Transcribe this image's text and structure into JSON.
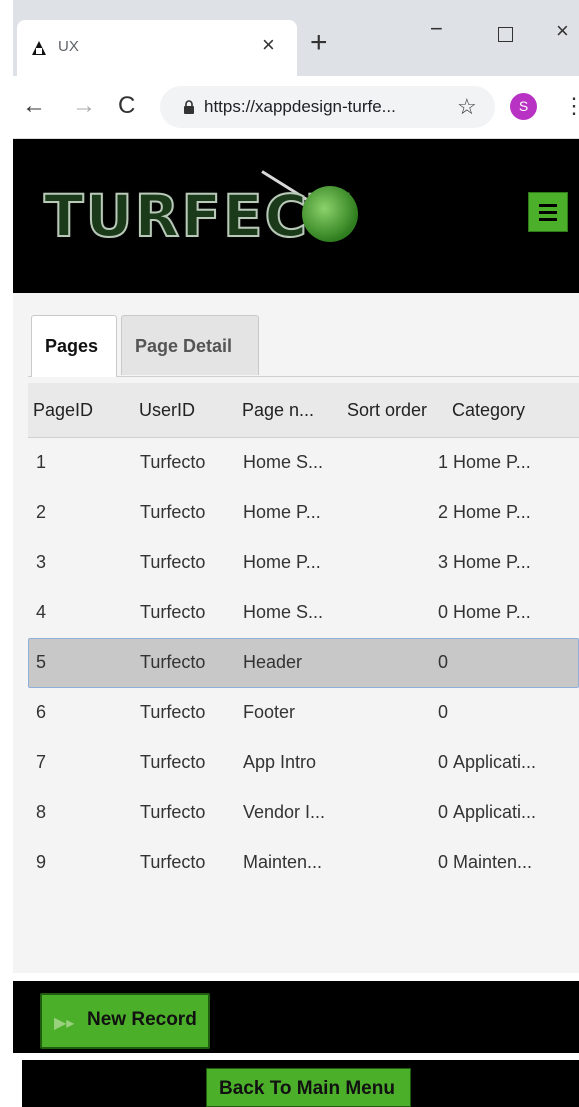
{
  "browser": {
    "tab_title": "UX",
    "tab_close": "×",
    "new_tab": "+",
    "minimize": "−",
    "close": "×",
    "url": "https://xappdesign-turfe...",
    "profile_initial": "S"
  },
  "header": {
    "logo_text": "TURFECT",
    "menu_icon": "hamburger-icon"
  },
  "tabs": [
    {
      "label": "Pages",
      "active": true
    },
    {
      "label": "Page Detail",
      "active": false
    }
  ],
  "grid": {
    "columns": [
      "PageID",
      "UserID",
      "Page n...",
      "Sort order",
      "Category"
    ],
    "rows": [
      {
        "id": "1",
        "user": "Turfecto",
        "page": "Home S...",
        "sort": "1",
        "category": "Home P..."
      },
      {
        "id": "2",
        "user": "Turfecto",
        "page": "Home P...",
        "sort": "2",
        "category": "Home P..."
      },
      {
        "id": "3",
        "user": "Turfecto",
        "page": "Home P...",
        "sort": "3",
        "category": "Home P..."
      },
      {
        "id": "4",
        "user": "Turfecto",
        "page": "Home S...",
        "sort": "0",
        "category": "Home P..."
      },
      {
        "id": "5",
        "user": "Turfecto",
        "page": "Header",
        "sort": "0",
        "category": "",
        "selected": true
      },
      {
        "id": "6",
        "user": "Turfecto",
        "page": "Footer",
        "sort": "0",
        "category": ""
      },
      {
        "id": "7",
        "user": "Turfecto",
        "page": "App Intro",
        "sort": "0",
        "category": "Applicati..."
      },
      {
        "id": "8",
        "user": "Turfecto",
        "page": "Vendor I...",
        "sort": "0",
        "category": "Applicati..."
      },
      {
        "id": "9",
        "user": "Turfecto",
        "page": "Mainten...",
        "sort": "0",
        "category": "Mainten..."
      }
    ]
  },
  "footer": {
    "new_record_label": "New Record",
    "back_label": "Back To Main Menu"
  },
  "colors": {
    "accent_green": "#4caf2a",
    "header_bg": "#000000",
    "selected_row": "#c8c8c8",
    "profile": "#b833c4"
  }
}
